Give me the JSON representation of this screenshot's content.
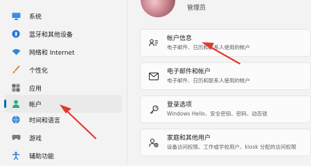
{
  "sidebar": {
    "items": [
      {
        "label": "系统",
        "icon": "monitor-icon",
        "active": false
      },
      {
        "label": "蓝牙和其他设备",
        "icon": "bluetooth-icon",
        "active": false
      },
      {
        "label": "网络和 Internet",
        "icon": "wifi-icon",
        "active": false
      },
      {
        "label": "个性化",
        "icon": "brush-icon",
        "active": false
      },
      {
        "label": "应用",
        "icon": "apps-icon",
        "active": false
      },
      {
        "label": "帐户",
        "icon": "account-icon",
        "active": true
      },
      {
        "label": "时间和语言",
        "icon": "globe-clock-icon",
        "active": false
      },
      {
        "label": "游戏",
        "icon": "gamepad-icon",
        "active": false
      },
      {
        "label": "辅助功能",
        "icon": "accessibility-icon",
        "active": false
      }
    ]
  },
  "header": {
    "user_role": "管理员"
  },
  "cards": [
    {
      "title": "帐户信息",
      "subtitle": "电子邮件、日历和联系人使用的帐户",
      "icon": "person-card-icon"
    },
    {
      "title": "电子邮件和帐户",
      "subtitle": "电子邮件、日历和联系人使用的帐户",
      "icon": "mail-icon"
    },
    {
      "title": "登录选项",
      "subtitle": "Windows Hello、安全密钥、密码、动态锁",
      "icon": "key-icon"
    },
    {
      "title": "家庭和其他用户",
      "subtitle": "设备访问权限、工作或学校用户、kiosk 分配的访问权限",
      "icon": "family-icon"
    }
  ],
  "colors": {
    "accent": "#0067c0",
    "annotation_arrow": "#e03a2f"
  }
}
